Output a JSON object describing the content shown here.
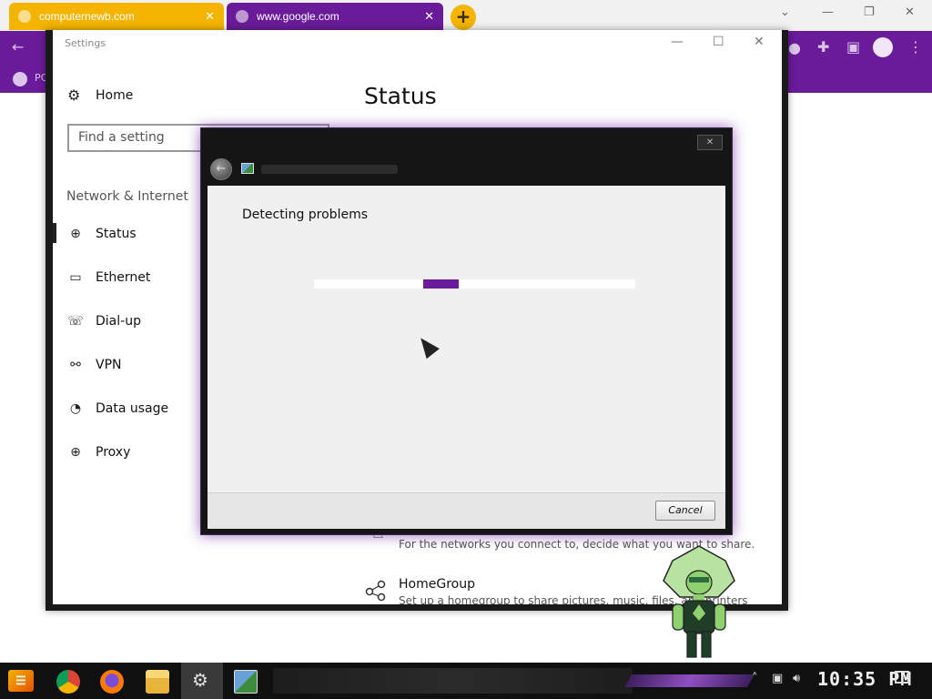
{
  "browser": {
    "tabs": [
      {
        "title": "computernewb.com",
        "color": "#f4b400"
      },
      {
        "title": "www.google.com",
        "color": "#6a1b9a"
      }
    ],
    "new_tab": "+",
    "bookmark_label": "PC"
  },
  "settings": {
    "window_title": "Settings",
    "home_label": "Home",
    "search_placeholder": "Find a setting",
    "section_label": "Network & Internet",
    "page_title": "Status",
    "nav": [
      {
        "label": "Status",
        "icon": "globe-status-icon",
        "active": true
      },
      {
        "label": "Ethernet",
        "icon": "ethernet-icon",
        "active": false
      },
      {
        "label": "Dial-up",
        "icon": "dialup-icon",
        "active": false
      },
      {
        "label": "VPN",
        "icon": "vpn-icon",
        "active": false
      },
      {
        "label": "Data usage",
        "icon": "data-usage-icon",
        "active": false
      },
      {
        "label": "Proxy",
        "icon": "globe-proxy-icon",
        "active": false
      }
    ],
    "sharing_description": "For the networks you connect to, decide what you want to share.",
    "homegroup_title": "HomeGroup",
    "homegroup_description": "Set up a homegroup to share pictures, music, files, and printers"
  },
  "troubleshooter": {
    "heading": "Detecting problems",
    "progress_fraction": 0.34,
    "progress_block": 0.11,
    "cancel_label": "Cancel",
    "close_label": "✕"
  },
  "taskbar": {
    "clock": "10:35 PM",
    "accent": "#6a1b9a"
  }
}
